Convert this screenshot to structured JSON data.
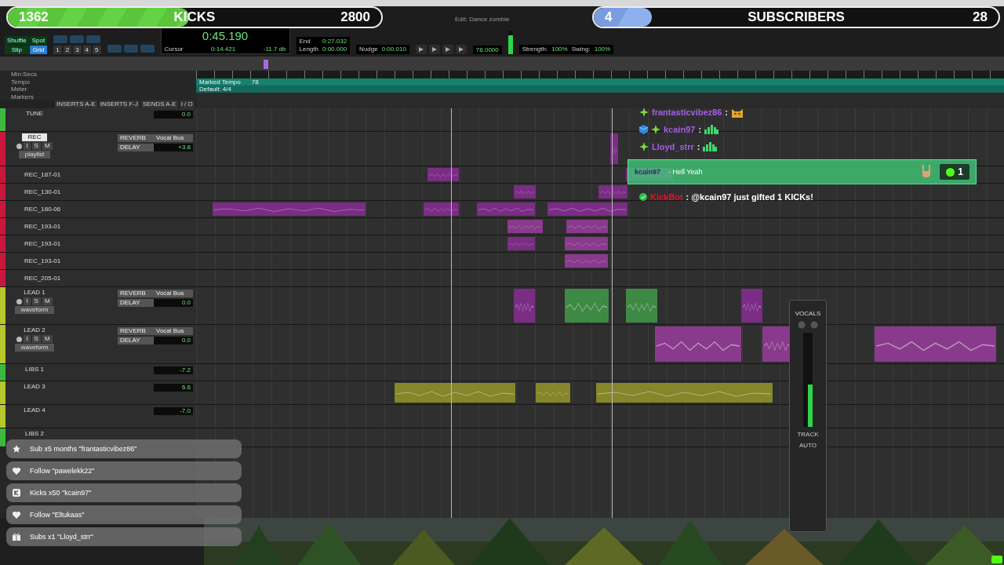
{
  "window": {
    "title": "Edit: Dance zombie"
  },
  "kicks_goal": {
    "current": "1362",
    "label": "KICKS",
    "goal": "2800",
    "level": 0.486
  },
  "subs_goal": {
    "current": "4",
    "label": "SUBSCRIBERS",
    "goal": "28",
    "level": 0.143
  },
  "toolbar": {
    "edit_modes": [
      {
        "label": "Shuffle",
        "selected": false
      },
      {
        "label": "Spot",
        "selected": false
      },
      {
        "label": "Slip",
        "selected": false
      },
      {
        "label": "Grid",
        "selected": true
      }
    ],
    "zoom_presets": [
      "1",
      "2",
      "3",
      "4",
      "5"
    ],
    "main_counter": "0:45.190",
    "cursor_label": "Cursor",
    "cursor_value": "0:14.421",
    "cursor_level": "-11.7 db",
    "range": [
      {
        "label": "End",
        "value": "0:27.032"
      },
      {
        "label": "Length",
        "value": "0:00.000"
      }
    ],
    "nudge_label": "Nudge",
    "nudge_value": "0:00.010",
    "tempo_value": "78.0000",
    "grid_settings": [
      {
        "label": "Strength:",
        "value": "100%"
      },
      {
        "label": "Swing:",
        "value": "100%"
      }
    ]
  },
  "rulers": {
    "labels": [
      "Min:Secs",
      "Tempo",
      "Meter",
      "Markers"
    ],
    "tempo": "Marked Tempo",
    "tempo_value": "78",
    "meter": "Default: 4/4"
  },
  "columns": [
    "INSERTS A-E",
    "INSERTS F-J",
    "SENDS A-E",
    "I / O"
  ],
  "tracks": [
    {
      "name": "TUNE",
      "kind": "compact",
      "color": "#3fb83f",
      "selected": false,
      "volume": "0.0"
    },
    {
      "name": "REC",
      "kind": "full",
      "color": "#c8163c",
      "selected": true,
      "buttons": [
        "I",
        "S",
        "M"
      ],
      "view": "playlist",
      "sends": [
        "REVERB",
        "DELAY"
      ],
      "output": "Vocal Bus",
      "volume": "+3.8",
      "playlists": [
        {
          "name": "REC_187-01"
        },
        {
          "name": "REC_130-01"
        },
        {
          "name": "REC_180-06"
        },
        {
          "name": "REC_193-01"
        },
        {
          "name": "REC_193-01"
        },
        {
          "name": "REC_193-01"
        },
        {
          "name": "REC_205-01"
        }
      ]
    },
    {
      "name": "LEAD 1",
      "kind": "full",
      "color": "#b5c72a",
      "selected": false,
      "buttons": [
        "I",
        "S",
        "M"
      ],
      "view": "waveform",
      "sends": [
        "REVERB",
        "DELAY"
      ],
      "output": "Vocal Bus",
      "volume": "0.0"
    },
    {
      "name": "LEAD 2",
      "kind": "full",
      "color": "#b5c72a",
      "selected": false,
      "buttons": [
        "I",
        "S",
        "M"
      ],
      "view": "waveform",
      "sends": [
        "REVERB",
        "DELAY"
      ],
      "output": "Vocal Bus",
      "volume": "0.0"
    },
    {
      "name": "LIBS 1",
      "kind": "compact",
      "color": "#3fb83f",
      "selected": false,
      "volume": "-7.2"
    },
    {
      "name": "LEAD 3",
      "kind": "compact",
      "color": "#b5c72a",
      "selected": false,
      "volume": "6.6"
    },
    {
      "name": "LEAD 4",
      "kind": "compact",
      "color": "#b5c72a",
      "selected": false,
      "volume": "-7.0"
    },
    {
      "name": "LIBS 2",
      "kind": "compact",
      "color": "#3fb83f",
      "selected": false
    }
  ],
  "mixer_strip": {
    "name": "VOCALS",
    "labels": [
      "TRACK",
      "AUTO"
    ],
    "level": 0.45
  },
  "chat": [
    {
      "user": "frantasticvibez86",
      "separator": ":",
      "color": "#a45ee8",
      "badges": [
        {
          "kind": "sparkle"
        }
      ],
      "emote": {
        "kind": "cat"
      }
    },
    {
      "user": "kcain97",
      "separator": ":",
      "color": "#a45ee8",
      "badges": [
        {
          "kind": "cube"
        },
        {
          "kind": "sparkle"
        }
      ],
      "emote": {
        "kind": "bars"
      }
    },
    {
      "user": "Lloyd_strr",
      "separator": ":",
      "color": "#a45ee8",
      "badges": [
        {
          "kind": "sparkle"
        }
      ],
      "emote": {
        "kind": "bars"
      }
    }
  ],
  "highlight": {
    "user": "kcain97",
    "message": "- Hell Yeah",
    "amount": "1"
  },
  "bot_message": {
    "user": "KickBot",
    "color": "#e0142c",
    "message": ": @kcain97 just gifted 1 KICKs!"
  },
  "alerts": [
    {
      "kind": "star",
      "text": "Sub x5 months \"frantasticvibez86\""
    },
    {
      "kind": "heart",
      "text": "Follow \"pawelekk22\""
    },
    {
      "kind": "kick",
      "text": "Kicks x50 \"kcain97\""
    },
    {
      "kind": "heart",
      "text": "Follow \"Eltukaas\""
    },
    {
      "kind": "gift",
      "text": "Subs x1 \"Lloyd_strr\""
    }
  ]
}
